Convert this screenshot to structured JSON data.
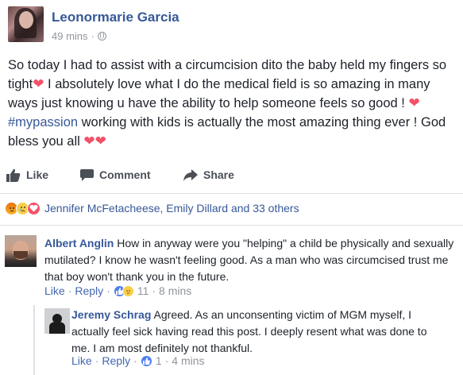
{
  "post": {
    "author": "Leonormarie Garcia",
    "time": "49 mins",
    "separator": "·",
    "audience_icon": "globe-icon",
    "text_1": "So today I had to assist with a circumcision dito the baby held my fingers so tight",
    "text_2": " I absolutely love what I do the medical field is so amazing in many ways just knowing u have the ability to help someone feels so good ! ",
    "hashtag": "#mypassion",
    "text_3": " working with kids is actually the most amazing thing ever ! God bless you all ",
    "heart": "❤",
    "heart_color": "#f25268"
  },
  "actions": {
    "like": "Like",
    "comment": "Comment",
    "share": "Share"
  },
  "reactions": {
    "icons": [
      "angry-icon",
      "sad-icon",
      "love-icon"
    ],
    "names": "Jennifer McFetacheese, Emily Dillard and 33 others"
  },
  "comments": [
    {
      "author": "Albert Anglin",
      "text": "How in anyway were you \"helping\" a child be physically and sexually mutilated? I know he wasn't feeling good. As a man who was circumcised trust me that boy won't thank you in the future.",
      "like": "Like",
      "reply": "Reply",
      "dot": "·",
      "reaction_count": "11",
      "time": "8 mins"
    },
    {
      "author": "Jeremy Schrag",
      "text": "Agreed. As an unconsenting victim of MGM myself, I actually feel sick having read this post. I deeply resent what was done to me. I am most definitely not thankful.",
      "like": "Like",
      "reply": "Reply",
      "dot": "·",
      "reaction_count": "1",
      "time": "4 mins"
    }
  ],
  "colors": {
    "link": "#365899",
    "meta": "#90949c",
    "divider": "#dddfe2"
  }
}
